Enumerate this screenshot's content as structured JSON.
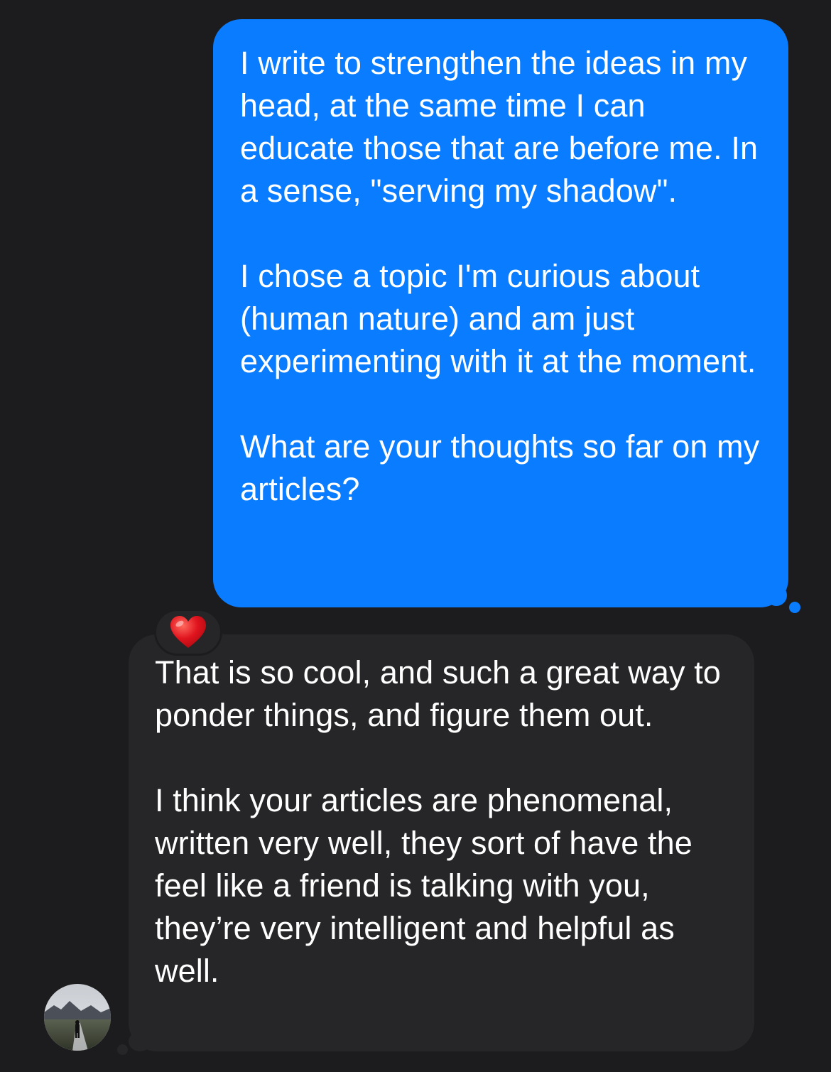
{
  "conversation": {
    "outgoing": {
      "paragraphs": [
        "I write to strengthen the ideas in my head, at the same time I can educate those that are before me. In a sense, \"serving my shadow\".",
        "I chose a topic I'm curious about (human nature) and am just experimenting with it at the moment.",
        "What are your thoughts so far on my articles?"
      ]
    },
    "reaction": {
      "icon": "heart-icon",
      "color": "#e0141e"
    },
    "incoming": {
      "paragraphs": [
        "That is so cool, and such a great way to ponder things, and figure them out.",
        "I think your articles are phenomenal, written very well, they sort of have the feel like a friend is talking with you, they’re very intelligent and helpful as well."
      ]
    },
    "avatar": {
      "icon": "avatar-photo"
    }
  },
  "colors": {
    "background": "#1c1c1e",
    "outgoing_bubble": "#0a7cff",
    "incoming_bubble": "#262628",
    "text": "#ffffff"
  }
}
